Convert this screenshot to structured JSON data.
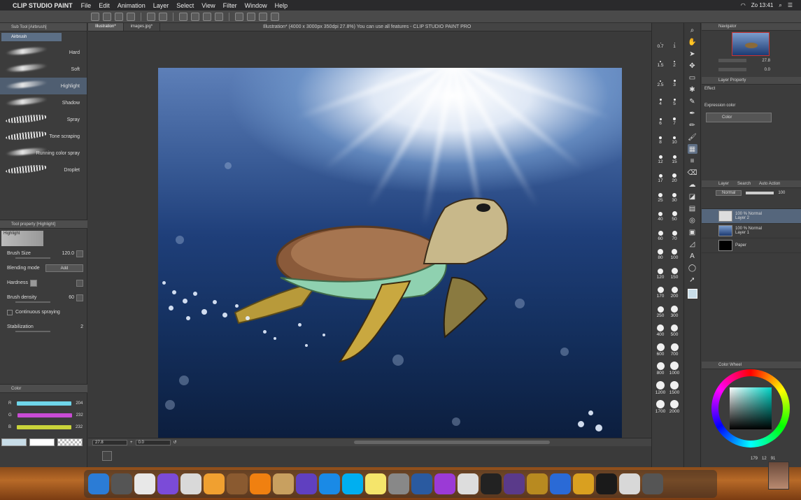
{
  "menubar": {
    "app_name": "CLIP STUDIO PAINT",
    "menus": [
      "File",
      "Edit",
      "Animation",
      "Layer",
      "Select",
      "View",
      "Filter",
      "Window",
      "Help"
    ],
    "clock": "Zo 13:41"
  },
  "left_panel": {
    "sub_tool_title": "Sub Tool [Airbrush]",
    "active_tab": "Airbrush",
    "brushes": [
      "Hard",
      "Soft",
      "Highlight",
      "Shadow",
      "Spray",
      "Tone scraping",
      "Running color spray",
      "Droplet"
    ],
    "selected_brush": "Highlight",
    "tool_property_title": "Tool property [Highlight]",
    "preview_label": "Highlight",
    "brush_size_label": "Brush Size",
    "brush_size_value": "120.0",
    "blending_mode_label": "Blending mode",
    "blending_mode_value": "Add",
    "hardness_label": "Hardness",
    "brush_density_label": "Brush density",
    "brush_density_value": "60",
    "continuous_spraying_label": "Continuous spraying",
    "stabilization_label": "Stabilization",
    "stabilization_value": "2",
    "color_title": "Color",
    "rgb": [
      {
        "channel": "R",
        "value": "204",
        "color": "#6fd6ea"
      },
      {
        "channel": "G",
        "value": "232",
        "color": "#c94bd4"
      },
      {
        "channel": "B",
        "value": "232",
        "color": "#c9d43a"
      }
    ]
  },
  "canvas": {
    "doc_tabs": [
      "Illustration*",
      "images.jpg*"
    ],
    "active_doc_tab": "Illustration*",
    "title": "Illustration* (4000 x 3000px 350dpi 27.8%)  You can use all features - CLIP STUDIO PAINT PRO",
    "zoom": "27.8",
    "rotation": "0.0"
  },
  "brush_sizes": [
    "0.7",
    "1",
    "1.5",
    "2",
    "2.5",
    "3",
    "4",
    "5",
    "6",
    "7",
    "8",
    "10",
    "12",
    "15",
    "17",
    "20",
    "25",
    "30",
    "40",
    "50",
    "60",
    "70",
    "80",
    "100",
    "120",
    "150",
    "170",
    "200",
    "250",
    "300",
    "400",
    "500",
    "600",
    "700",
    "800",
    "1000",
    "1200",
    "1500",
    "1700",
    "2000"
  ],
  "right_panel": {
    "navigator_title": "Navigator",
    "nav_zoom": "27.8",
    "nav_rotation": "0.0",
    "layer_property_title": "Layer Property",
    "effect_label": "Effect",
    "expression_color_label": "Expression color",
    "expression_color_value": "Color",
    "layer_tabs": [
      "Layer",
      "Search",
      "Auto Action"
    ],
    "blend_mode": "Normal",
    "opacity": "100",
    "layers": [
      {
        "mode": "100 % Normal",
        "name": "Layer 2",
        "selected": true
      },
      {
        "mode": "100 % Normal",
        "name": "Layer 1",
        "selected": false
      },
      {
        "mode": "",
        "name": "Paper",
        "selected": false
      }
    ],
    "color_wheel_title": "Color Wheel",
    "wheel_values": [
      "179",
      "12",
      "91"
    ]
  },
  "dock": {
    "apps": [
      "finder-icon",
      "launchpad-icon",
      "chrome-icon",
      "siri-icon",
      "notes-icon",
      "photos-icon",
      "script-icon",
      "vlc-icon",
      "archive-icon",
      "imovie-star-icon",
      "app-store-icon",
      "skype-icon",
      "stickies-icon",
      "system-preferences-icon",
      "virtualbox-icon",
      "podcasts-icon",
      "spiral-icon",
      "apple-tv-icon",
      "video-editor-icon",
      "imovie-icon",
      "quicktime-icon",
      "pencil-app-icon",
      "clip-studio-icon",
      "preview-icon",
      "trash-icon"
    ]
  }
}
